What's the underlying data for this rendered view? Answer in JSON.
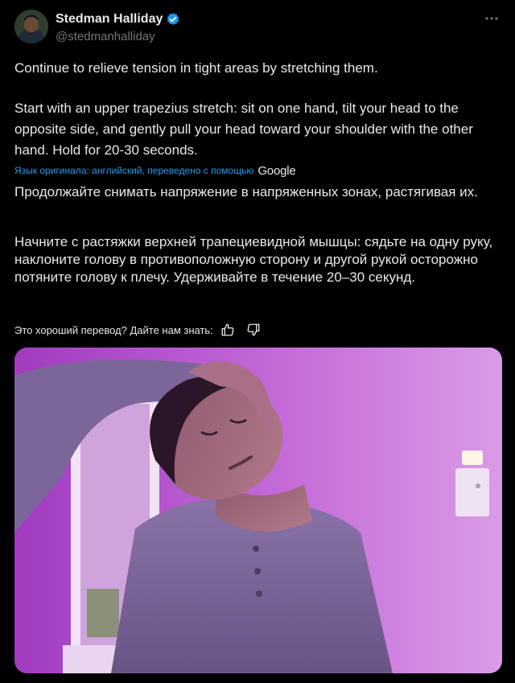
{
  "tweet": {
    "author": {
      "display_name": "Stedman Halliday",
      "handle": "@stedmanhalliday",
      "verified": true,
      "avatar_icon": "avatar-photo"
    },
    "more_icon": "more-horizontal-icon",
    "text_paragraphs": [
      "Continue to relieve tension in tight areas by stretching them.",
      "Start with an upper trapezius stretch: sit on one hand, tilt your head to the opposite side, and gently pull your head toward your shoulder with the other hand. Hold for 20-30 seconds."
    ],
    "translation": {
      "note": "Язык оригинала: английский, переведено с помощью",
      "provider": "Google",
      "paragraphs": [
        "Продолжайте снимать напряжение в напряженных зонах, растягивая их.",
        "Начните с растяжки верхней трапециевидной мышцы: сядьте на одну руку, наклоните голову в противоположную сторону и другой рукой осторожно потяните голову к плечу. Удерживайте в течение 20–30 секунд."
      ],
      "feedback_prompt": "Это хороший перевод? Дайте нам знать:",
      "feedback_icons": [
        "thumbs-up-icon",
        "thumbs-down-icon"
      ]
    },
    "media": {
      "type": "photo",
      "icon": "photo-image"
    }
  },
  "colors": {
    "background": "#000000",
    "text_primary": "#e7e9ea",
    "text_secondary": "#71767b",
    "accent_link": "#1d9bf0",
    "verified_badge": "#1d9bf0",
    "photo_tint": "#b04dd4"
  }
}
